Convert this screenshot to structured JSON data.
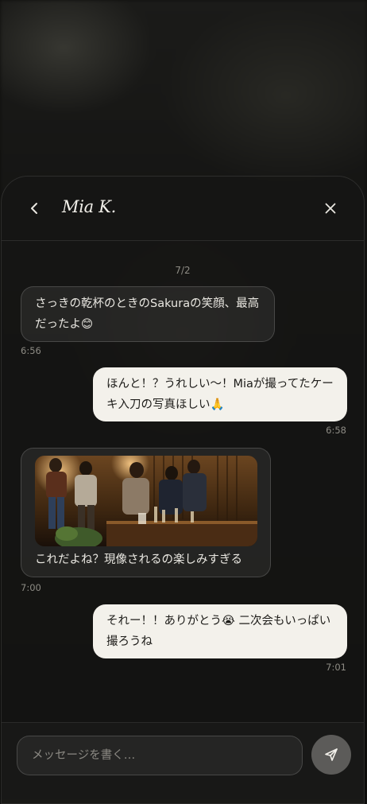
{
  "contact": {
    "name": "Mia K."
  },
  "date_separator": "7/2",
  "messages": [
    {
      "direction": "in",
      "text": "さっきの乾杯のときのSakuraの笑顔、最高だったよ😊",
      "time": "6:56"
    },
    {
      "direction": "out",
      "text": "ほんと！？うれしい〜！Miaが撮ってたケーキ入刀の写真ほしい🙏",
      "time": "6:58"
    },
    {
      "direction": "in",
      "text": "これだよね？現像されるの楽しみすぎる",
      "time": "7:00",
      "attachment": "party-photo"
    },
    {
      "direction": "out",
      "text": "それー！！ありがとう😭 二次会もいっぱい撮ろうね",
      "time": "7:01"
    }
  ],
  "composer": {
    "placeholder": "メッセージを書く…",
    "value": ""
  },
  "icons": {
    "back": "chevron-left-icon",
    "close": "close-icon",
    "send": "send-icon"
  },
  "colors": {
    "incoming_bubble": "#2a2a27",
    "outgoing_bubble": "#f3f1eb",
    "background": "#0e0e0d"
  }
}
